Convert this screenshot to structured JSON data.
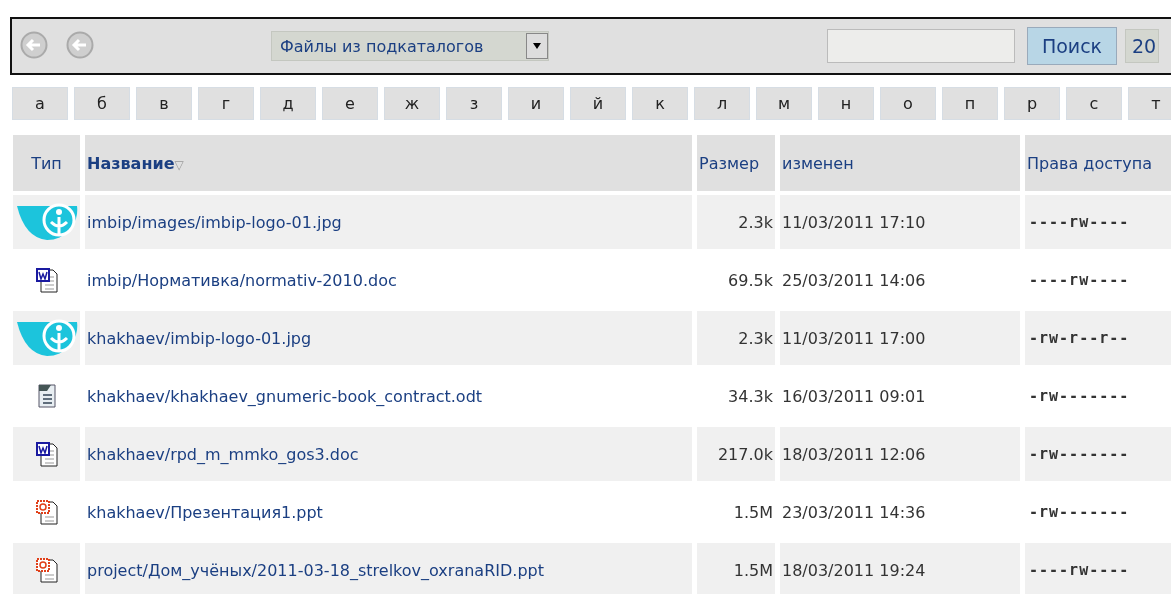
{
  "toolbar": {
    "filter": {
      "value": "Файлы из подкаталогов"
    },
    "search_button": "Поиск",
    "page_size": "20"
  },
  "letters": [
    "а",
    "б",
    "в",
    "г",
    "д",
    "е",
    "ж",
    "з",
    "и",
    "й",
    "к",
    "л",
    "м",
    "н",
    "о",
    "п",
    "р",
    "с",
    "т"
  ],
  "table": {
    "columns": [
      {
        "label": "Тип",
        "sorted": false
      },
      {
        "label": "Название",
        "sorted": true,
        "sort_mark": "▽"
      },
      {
        "label": "Размер",
        "sorted": false
      },
      {
        "label": "изменен",
        "sorted": false
      },
      {
        "label": "Права доступа",
        "sorted": false
      }
    ],
    "rows": [
      {
        "kind": "logo",
        "name": "imbip/images/imbip-logo-01.jpg",
        "size": "2.3k",
        "modified": "11/03/2011 17:10",
        "perms": "----rw----"
      },
      {
        "kind": "word",
        "name": "imbip/Нормативка/normativ-2010.doc",
        "size": "69.5k",
        "modified": "25/03/2011 14:06",
        "perms": "----rw----"
      },
      {
        "kind": "logo",
        "name": "khakhaev/imbip-logo-01.jpg",
        "size": "2.3k",
        "modified": "11/03/2011 17:00",
        "perms": "-rw-r--r--"
      },
      {
        "kind": "writer",
        "name": "khakhaev/khakhaev_gnumeric-book_contract.odt",
        "size": "34.3k",
        "modified": "16/03/2011 09:01",
        "perms": "-rw-------"
      },
      {
        "kind": "word",
        "name": "khakhaev/rpd_m_mmko_gos3.doc",
        "size": "217.0k",
        "modified": "18/03/2011 12:06",
        "perms": "-rw-------"
      },
      {
        "kind": "ppt",
        "name": "khakhaev/Презентация1.ppt",
        "size": "1.5M",
        "modified": "23/03/2011 14:36",
        "perms": "-rw-------"
      },
      {
        "kind": "ppt",
        "name": "project/Дом_учёных/2011-03-18_strelkov_oxranaRID.ppt",
        "size": "1.5M",
        "modified": "18/03/2011 19:24",
        "perms": "----rw----"
      }
    ]
  }
}
